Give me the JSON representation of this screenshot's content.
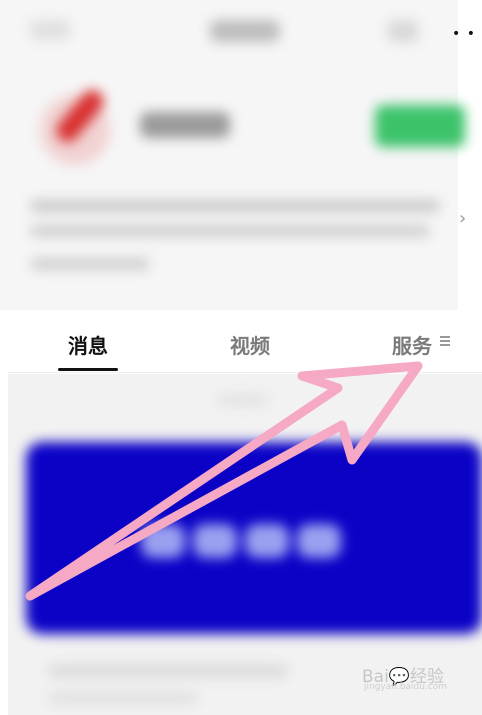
{
  "tabs": {
    "messages": "消息",
    "videos": "视频",
    "services": "服务"
  },
  "top_bar": {
    "more_icon": "more-dots-icon"
  },
  "header": {
    "chevron_icon": "chevron-right-icon"
  },
  "colors": {
    "banner": "#0b02c6",
    "follow_button": "#3cc36a",
    "arrow": "#f6a9c4",
    "active_tab": "#111111",
    "inactive_tab": "#7a7a7a"
  },
  "watermark": {
    "main": "Bai💬经验",
    "sub": "jingyan.baidu.com"
  }
}
